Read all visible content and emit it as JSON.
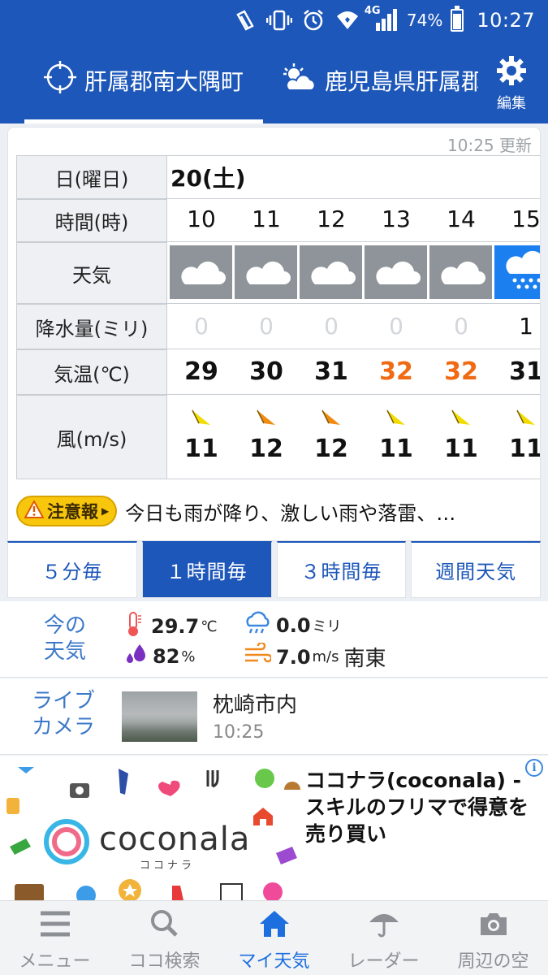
{
  "status_bar": {
    "battery_pct": "74%",
    "time": "10:27",
    "network": "4G"
  },
  "header": {
    "current_location": "肝属郡南大隅町",
    "saved_location": "鹿児島県肝属郡",
    "edit_label": "編集"
  },
  "forecast": {
    "updated": "10:25 更新",
    "labels": {
      "day": "日(曜日)",
      "hour": "時間(時)",
      "weather": "天気",
      "precip": "降水量(ミリ)",
      "temp": "気温(℃)",
      "wind": "風(m/s)"
    },
    "date": "20(土)",
    "hours": [
      "10",
      "11",
      "12",
      "13",
      "14",
      "15"
    ],
    "weather": [
      "cloudy-icon",
      "cloudy-icon",
      "cloudy-icon",
      "cloudy-icon",
      "cloudy-icon",
      "rain-icon"
    ],
    "precip": [
      "0",
      "0",
      "0",
      "0",
      "0",
      "1"
    ],
    "temp": [
      "29",
      "30",
      "31",
      "32",
      "32",
      "31"
    ],
    "wind_speed": [
      "11",
      "12",
      "12",
      "11",
      "11",
      "11"
    ],
    "wind_color": [
      "#f2dc00",
      "#f28a10",
      "#f28a10",
      "#f2dc00",
      "#f2dc00",
      "#f2dc00"
    ],
    "alert_badge": "注意報",
    "alert_text": "今日も雨が降り、激しい雨や落雷、…"
  },
  "view_tabs": [
    "５分毎",
    "１時間毎",
    "３時間毎",
    "週間天気"
  ],
  "current": {
    "title_line1": "今の",
    "title_line2": "天気",
    "temp": "29.7",
    "temp_unit": "℃",
    "rain": "0.0",
    "rain_unit": "ミリ",
    "humidity": "82",
    "humidity_unit": "%",
    "wind": "7.0",
    "wind_unit": "m/s",
    "wind_dir": "南東"
  },
  "livecam": {
    "title_line1": "ライブ",
    "title_line2": "カメラ",
    "place": "枕崎市内",
    "time": "10:25"
  },
  "ad": {
    "text": "ココナラ(coconala) - スキルのフリマで得意を売り買い",
    "logo": "coconala",
    "logo_sub": "ココナラ",
    "info": "i"
  },
  "nav": [
    "メニュー",
    "ココ検索",
    "マイ天気",
    "レーダー",
    "周辺の空"
  ],
  "colors": {
    "brand": "#1d57b9",
    "hot": "#f06a14",
    "rain_box": "#1b7ff0"
  }
}
